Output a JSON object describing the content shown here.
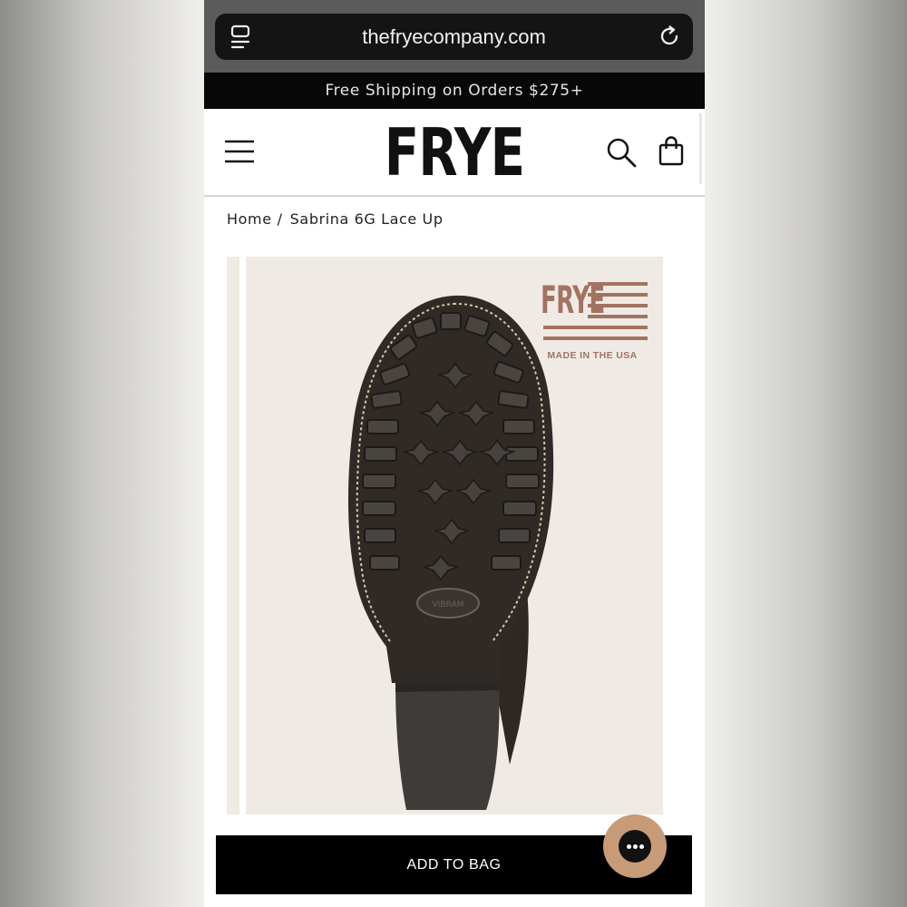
{
  "browser": {
    "url": "thefryecompany.com",
    "tabs_icon": "tabs-icon",
    "reload_icon": "reload-icon"
  },
  "promo_banner": {
    "text": "Free Shipping on Orders $275+"
  },
  "header": {
    "logo": "FRYE",
    "menu_icon": "hamburger-menu-icon",
    "search_icon": "search-icon",
    "bag_icon": "shopping-bag-icon"
  },
  "breadcrumb": {
    "home": "Home",
    "separator": "/",
    "current": "Sabrina 6G Lace Up"
  },
  "product_image": {
    "badge_logo": "FRYE",
    "badge_caption": "MADE IN THE USA",
    "sole_brand": "VIBRAM"
  },
  "actions": {
    "add_to_bag": "ADD TO BAG",
    "chat_icon": "chat-bubble-icon"
  },
  "colors": {
    "promo_background": "#080808",
    "button_background": "#000000",
    "chat_button": "#c79b77",
    "badge": "#a37362",
    "image_background": "#efebe4"
  }
}
